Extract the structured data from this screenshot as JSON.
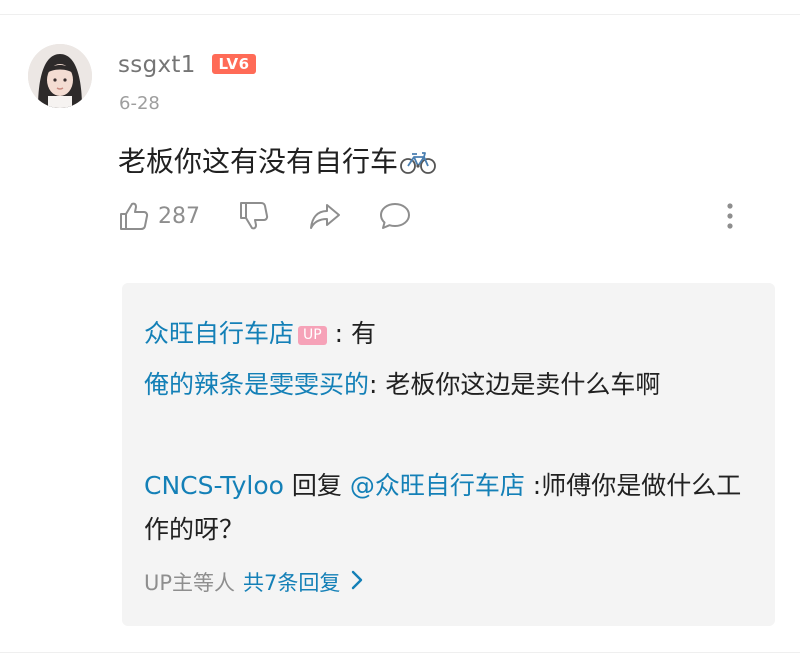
{
  "comment": {
    "username": "ssgxt1",
    "level_badge": "LV6",
    "date": "6-28",
    "text": "老板你这有没有自行车",
    "emoji_icon": "bicycle-icon",
    "likes": "287"
  },
  "replies": [
    {
      "author": "众旺自行车店",
      "badge": "UP",
      "separator": " : ",
      "text": "有"
    },
    {
      "author": "俺的辣条是雯雯买的",
      "separator": ": ",
      "text": "老板你这边是卖什么车啊"
    },
    {
      "author": "CNCS-Tyloo",
      "reply_word": " 回复 ",
      "mention": "@众旺自行车店",
      "separator": " :",
      "text": "师傅你是做什么工作的呀？"
    }
  ],
  "more_replies": {
    "prefix": "UP主等人",
    "count_text": "共7条回复"
  },
  "colors": {
    "link": "#1480b7",
    "level_badge": "#ff6b57",
    "up_badge": "#f6a2b8",
    "reply_background": "#f4f4f4"
  }
}
